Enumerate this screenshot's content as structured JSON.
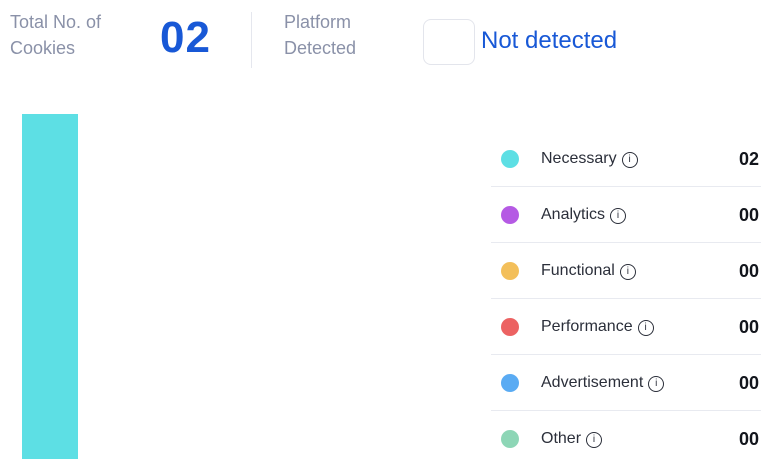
{
  "summary": {
    "total_label": "Total No. of Cookies",
    "total_count": "02",
    "platform_label": "Platform Detected",
    "platform_status": "Not detected"
  },
  "chart_data": {
    "type": "bar",
    "categories": [
      "Necessary",
      "Analytics",
      "Functional",
      "Performance",
      "Advertisement",
      "Other"
    ],
    "values": [
      2,
      0,
      0,
      0,
      0,
      0
    ],
    "stacked": true,
    "colors": [
      "#5ddfe4",
      "#b55ae4",
      "#f3bf5a",
      "#ec6262",
      "#5aabf3",
      "#8dd6b6"
    ]
  },
  "legend": {
    "items": [
      {
        "label": "Necessary",
        "count": "02",
        "color": "#5ddfe4",
        "icon": "info-icon"
      },
      {
        "label": "Analytics",
        "count": "00",
        "color": "#b55ae4",
        "icon": "info-icon"
      },
      {
        "label": "Functional",
        "count": "00",
        "color": "#f3bf5a",
        "icon": "info-icon"
      },
      {
        "label": "Performance",
        "count": "00",
        "color": "#ec6262",
        "icon": "info-icon"
      },
      {
        "label": "Advertisement",
        "count": "00",
        "color": "#5aabf3",
        "icon": "info-icon"
      },
      {
        "label": "Other",
        "count": "00",
        "color": "#8dd6b6",
        "icon": "info-icon"
      }
    ],
    "info_glyph": "i"
  }
}
